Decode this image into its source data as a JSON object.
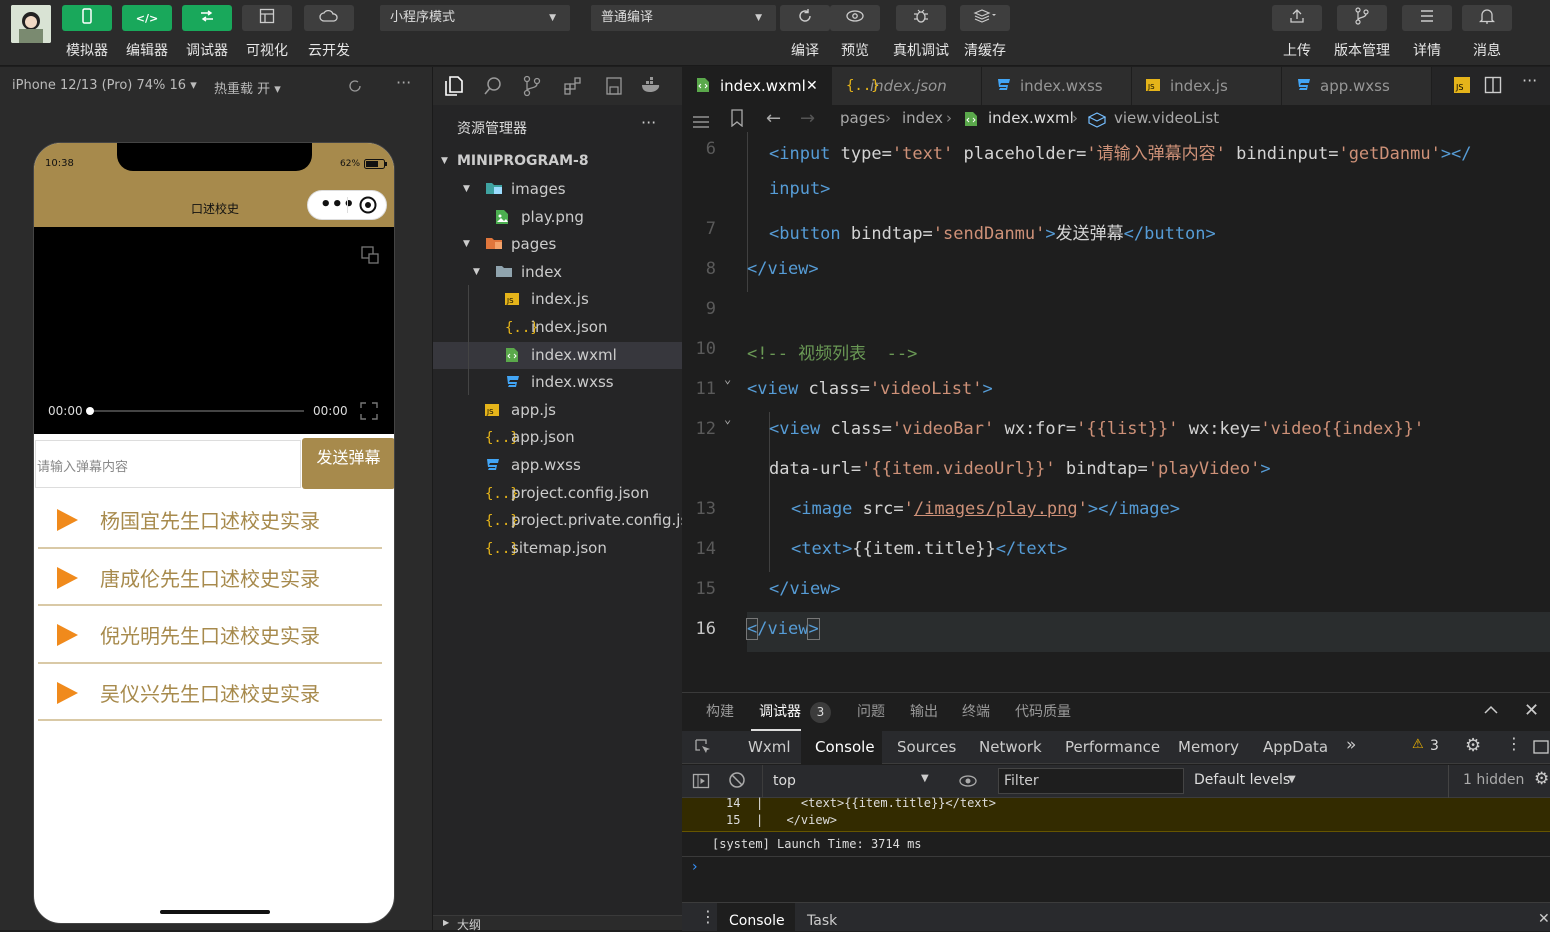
{
  "toolbar": {
    "left_buttons": [
      {
        "label": "模拟器",
        "icon": "phone-icon"
      },
      {
        "label": "编辑器",
        "icon": "code-icon"
      },
      {
        "label": "调试器",
        "icon": "debug-icon"
      },
      {
        "label": "可视化",
        "icon": "layout-icon"
      },
      {
        "label": "云开发",
        "icon": "cloud-icon"
      }
    ],
    "mode_select": "小程序模式",
    "compile_select": "普通编译",
    "center_buttons": [
      {
        "label": "编译",
        "icon": "refresh-icon"
      },
      {
        "label": "预览",
        "icon": "eye-icon"
      },
      {
        "label": "真机调试",
        "icon": "bug-icon"
      },
      {
        "label": "清缓存",
        "icon": "layers-icon"
      }
    ],
    "right_buttons": [
      {
        "label": "上传",
        "icon": "upload-icon"
      },
      {
        "label": "版本管理",
        "icon": "branch-icon"
      },
      {
        "label": "详情",
        "icon": "menu-icon"
      },
      {
        "label": "消息",
        "icon": "bell-icon"
      }
    ]
  },
  "simulator": {
    "device": "iPhone 12/13 (Pro) 74% 16 ▾",
    "hot_reload": "热重载 开 ▾",
    "time": "10:38",
    "battery": "62%",
    "nav_title": "口述校史",
    "video_time_current": "00:00",
    "video_time_total": "00:00",
    "input_placeholder": "请输入弹幕内容",
    "send_button": "发送弹幕",
    "video_list": [
      "杨国宜先生口述校史实录",
      "唐成伦先生口述校史实录",
      "倪光明先生口述校史实录",
      "吴仪兴先生口述校史实录"
    ],
    "accent_color": "#a78a4c"
  },
  "explorer": {
    "title": "资源管理器",
    "root": "MINIPROGRAM-8",
    "items": [
      {
        "name": "images",
        "type": "folder-img",
        "depth": 1,
        "open": true
      },
      {
        "name": "play.png",
        "type": "png",
        "depth": 2
      },
      {
        "name": "pages",
        "type": "folder-pages",
        "depth": 1,
        "open": true
      },
      {
        "name": "index",
        "type": "folder",
        "depth": 2,
        "open": true
      },
      {
        "name": "index.js",
        "type": "js",
        "depth": 3
      },
      {
        "name": "index.json",
        "type": "json",
        "depth": 3
      },
      {
        "name": "index.wxml",
        "type": "wxml",
        "depth": 3,
        "selected": true
      },
      {
        "name": "index.wxss",
        "type": "wxss",
        "depth": 3
      },
      {
        "name": "app.js",
        "type": "js",
        "depth": 1
      },
      {
        "name": "app.json",
        "type": "json",
        "depth": 1
      },
      {
        "name": "app.wxss",
        "type": "wxss",
        "depth": 1
      },
      {
        "name": "project.config.json",
        "type": "json",
        "depth": 1
      },
      {
        "name": "project.private.config.js...",
        "type": "json",
        "depth": 1
      },
      {
        "name": "sitemap.json",
        "type": "json",
        "depth": 1
      }
    ],
    "outline": "大纲"
  },
  "editor": {
    "tabs": [
      {
        "name": "index.wxml",
        "type": "wxml",
        "active": true,
        "closable": true
      },
      {
        "name": "index.json",
        "type": "json",
        "italic": true
      },
      {
        "name": "index.wxss",
        "type": "wxss"
      },
      {
        "name": "index.js",
        "type": "js"
      },
      {
        "name": "app.wxss",
        "type": "wxss"
      }
    ],
    "breadcrumb": [
      "pages",
      "index",
      "index.wxml",
      "view.videoList"
    ],
    "line_numbers": [
      "6",
      "7",
      "8",
      "9",
      "10",
      "11",
      "12",
      "13",
      "14",
      "15",
      "16"
    ]
  },
  "panel": {
    "tabs": [
      "构建",
      "调试器",
      "问题",
      "输出",
      "终端",
      "代码质量"
    ],
    "active_tab": "调试器",
    "debugger_badge": "3",
    "devtools_tabs": [
      "Wxml",
      "Console",
      "Sources",
      "Network",
      "Performance",
      "Memory",
      "AppData"
    ],
    "active_devtools_tab": "Console",
    "warnings_count": "3",
    "context": "top",
    "filter_placeholder": "Filter",
    "levels": "Default levels",
    "hidden": "1 hidden",
    "console_lines": [
      {
        "num": "14",
        "code": "    <text>{{item.title}}</text>"
      },
      {
        "num": "15",
        "code": "  </view>"
      }
    ],
    "system_log": "[system] Launch Time: 3714 ms",
    "drawer_tabs": [
      "Console",
      "Task"
    ]
  }
}
